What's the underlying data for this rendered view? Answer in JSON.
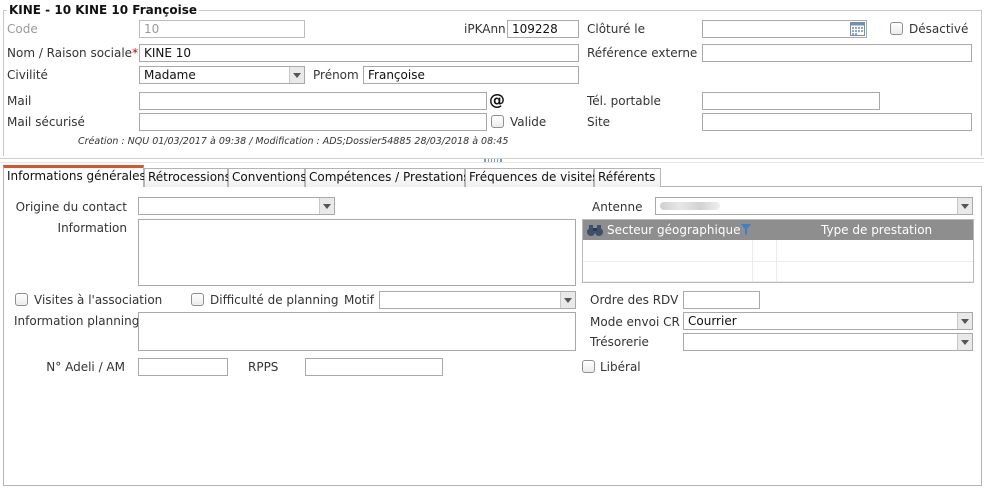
{
  "header": {
    "title": "KINE - 10 KINE 10 Françoise",
    "code_label": "Code",
    "code_value": "10",
    "ipkann_label": "iPKAnn",
    "ipkann_value": "109228",
    "cloture_label": "Clôturé le",
    "cloture_value": "",
    "desactive_label": "Désactivé",
    "nom_label": "Nom / Raison sociale",
    "required_mark": "*",
    "nom_value": "KINE 10",
    "ref_externe_label": "Référence externe",
    "ref_externe_value": "",
    "civilite_label": "Civilité",
    "civilite_value": "Madame",
    "prenom_label": "Prénom",
    "prenom_value": "Françoise",
    "mail_label": "Mail",
    "mail_value": "",
    "at_symbol": "@",
    "tel_label": "Tél. portable",
    "tel_value": "",
    "mail_securise_label": "Mail sécurisé",
    "mail_securise_value": "",
    "valide_label": "Valide",
    "site_label": "Site",
    "site_value": "",
    "meta": "Création : NQU 01/03/2017 à 09:38 / Modification : ADS;Dossier54885 28/03/2018 à 08:45"
  },
  "tabs": [
    {
      "label": "Informations générales",
      "active": true
    },
    {
      "label": "Rétrocessions",
      "active": false
    },
    {
      "label": "Conventions",
      "active": false
    },
    {
      "label": "Compétences / Prestations",
      "active": false
    },
    {
      "label": "Fréquences de visites",
      "active": false
    },
    {
      "label": "Référents",
      "active": false
    }
  ],
  "general": {
    "origine_label": "Origine du contact",
    "origine_value": "",
    "information_label": "Information",
    "information_value": "",
    "antenne_label": "Antenne",
    "grid_col1": "Secteur géographique",
    "grid_col2": "Type de prestation",
    "visites_label": "Visites à l'association",
    "difficulte_label": "Difficulté de planning",
    "motif_label": "Motif",
    "motif_value": "",
    "ordre_rdv_label": "Ordre des RDV",
    "ordre_rdv_value": "",
    "info_planning_label": "Information planning",
    "info_planning_value": "",
    "mode_envoi_label": "Mode envoi CR",
    "mode_envoi_value": "Courrier",
    "tresorerie_label": "Trésorerie",
    "tresorerie_value": "",
    "adeli_label": "N° Adeli / AM",
    "adeli_value": "",
    "rpps_label": "RPPS",
    "rpps_value": "",
    "liberal_label": "Libéral"
  },
  "colors": {
    "active_tab_accent": "#d9542a",
    "required": "#cc0000",
    "grid_header": "#8e8e8e"
  }
}
